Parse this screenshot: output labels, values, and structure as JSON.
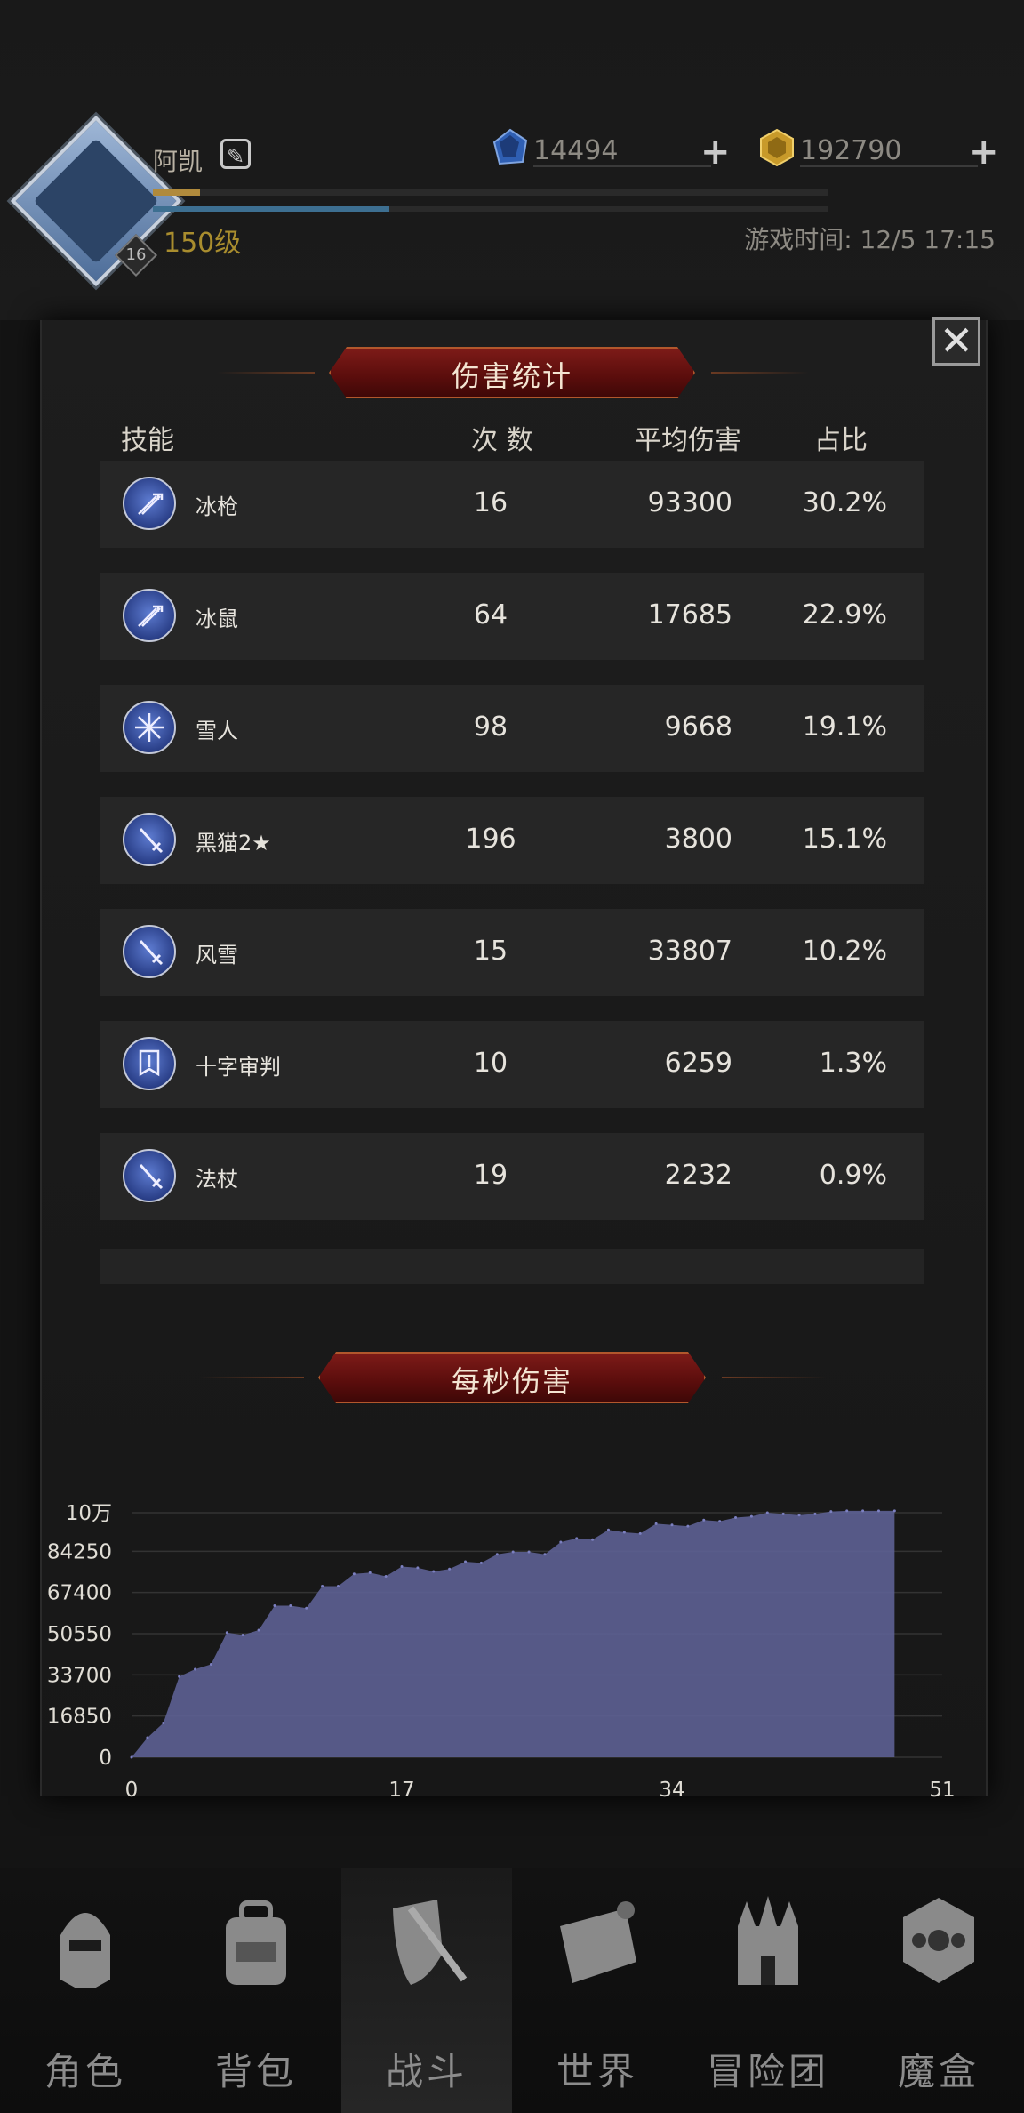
{
  "header": {
    "player_name": "阿凯",
    "level_text": "150级",
    "avatar_badge": "16",
    "exp_progress": 0.07,
    "mp_progress": 0.35,
    "game_time": "游戏时间: 12/5 17:15",
    "resources": [
      {
        "name": "blue-gem",
        "value": "14494",
        "color": "#2e5fb0"
      },
      {
        "name": "gold-gem",
        "value": "192790",
        "color": "#c89a2a"
      }
    ]
  },
  "damage_modal": {
    "title": "伤害统计",
    "columns": {
      "skill": "技能",
      "count": "次 数",
      "avg": "平均伤害",
      "share": "占比"
    },
    "rows": [
      {
        "skill": "冰枪",
        "count": "16",
        "avg": "93300",
        "share": "30.2%",
        "icon": "arrows-icon"
      },
      {
        "skill": "冰鼠",
        "count": "64",
        "avg": "17685",
        "share": "22.9%",
        "icon": "arrows-icon"
      },
      {
        "skill": "雪人",
        "count": "98",
        "avg": "9668",
        "share": "19.1%",
        "icon": "snowflake-icon"
      },
      {
        "skill": "黑猫2★",
        "count": "196",
        "avg": "3800",
        "share": "15.1%",
        "icon": "sword-icon"
      },
      {
        "skill": "风雪",
        "count": "15",
        "avg": "33807",
        "share": "10.2%",
        "icon": "sword-icon"
      },
      {
        "skill": "十字审判",
        "count": "10",
        "avg": "6259",
        "share": "1.3%",
        "icon": "banner-icon"
      },
      {
        "skill": "法杖",
        "count": "19",
        "avg": "2232",
        "share": "0.9%",
        "icon": "sword-icon"
      }
    ],
    "dps_title": "每秒伤害"
  },
  "chart_data": {
    "type": "area",
    "title": "每秒伤害",
    "xlabel": "",
    "ylabel": "",
    "xlim": [
      0,
      51
    ],
    "ylim": [
      0,
      101100
    ],
    "x_ticks": [
      "0",
      "17",
      "34",
      "51"
    ],
    "y_ticks": [
      "0",
      "16850",
      "33700",
      "50550",
      "67400",
      "84250",
      "10万"
    ],
    "series_color": "#5c5f91",
    "x": [
      0,
      1,
      2,
      3,
      4,
      5,
      6,
      7,
      8,
      9,
      10,
      11,
      12,
      13,
      14,
      15,
      16,
      17,
      18,
      19,
      20,
      21,
      22,
      23,
      24,
      25,
      26,
      27,
      28,
      29,
      30,
      31,
      32,
      33,
      34,
      35,
      36,
      37,
      38,
      39,
      40,
      41,
      42,
      43,
      44,
      45,
      46,
      47,
      48
    ],
    "values": [
      0,
      8000,
      14000,
      33000,
      36000,
      38000,
      51000,
      50000,
      52000,
      62000,
      62000,
      61000,
      70000,
      70000,
      75000,
      75500,
      74000,
      78000,
      77500,
      76000,
      77000,
      80000,
      79500,
      83000,
      84000,
      84000,
      83000,
      88000,
      89500,
      89000,
      93000,
      92000,
      91500,
      95500,
      95000,
      94500,
      97000,
      96500,
      98000,
      98500,
      100000,
      99500,
      99000,
      99500,
      100500,
      100800,
      100800,
      100800,
      100800
    ]
  },
  "nav": {
    "items": [
      {
        "label": "角色",
        "icon": "helmet-icon"
      },
      {
        "label": "背包",
        "icon": "backpack-icon"
      },
      {
        "label": "战斗",
        "icon": "shield-sword-icon"
      },
      {
        "label": "世界",
        "icon": "map-scroll-icon"
      },
      {
        "label": "冒险团",
        "icon": "castle-icon"
      },
      {
        "label": "魔盒",
        "icon": "magic-cube-icon"
      }
    ],
    "active_index": 2
  }
}
